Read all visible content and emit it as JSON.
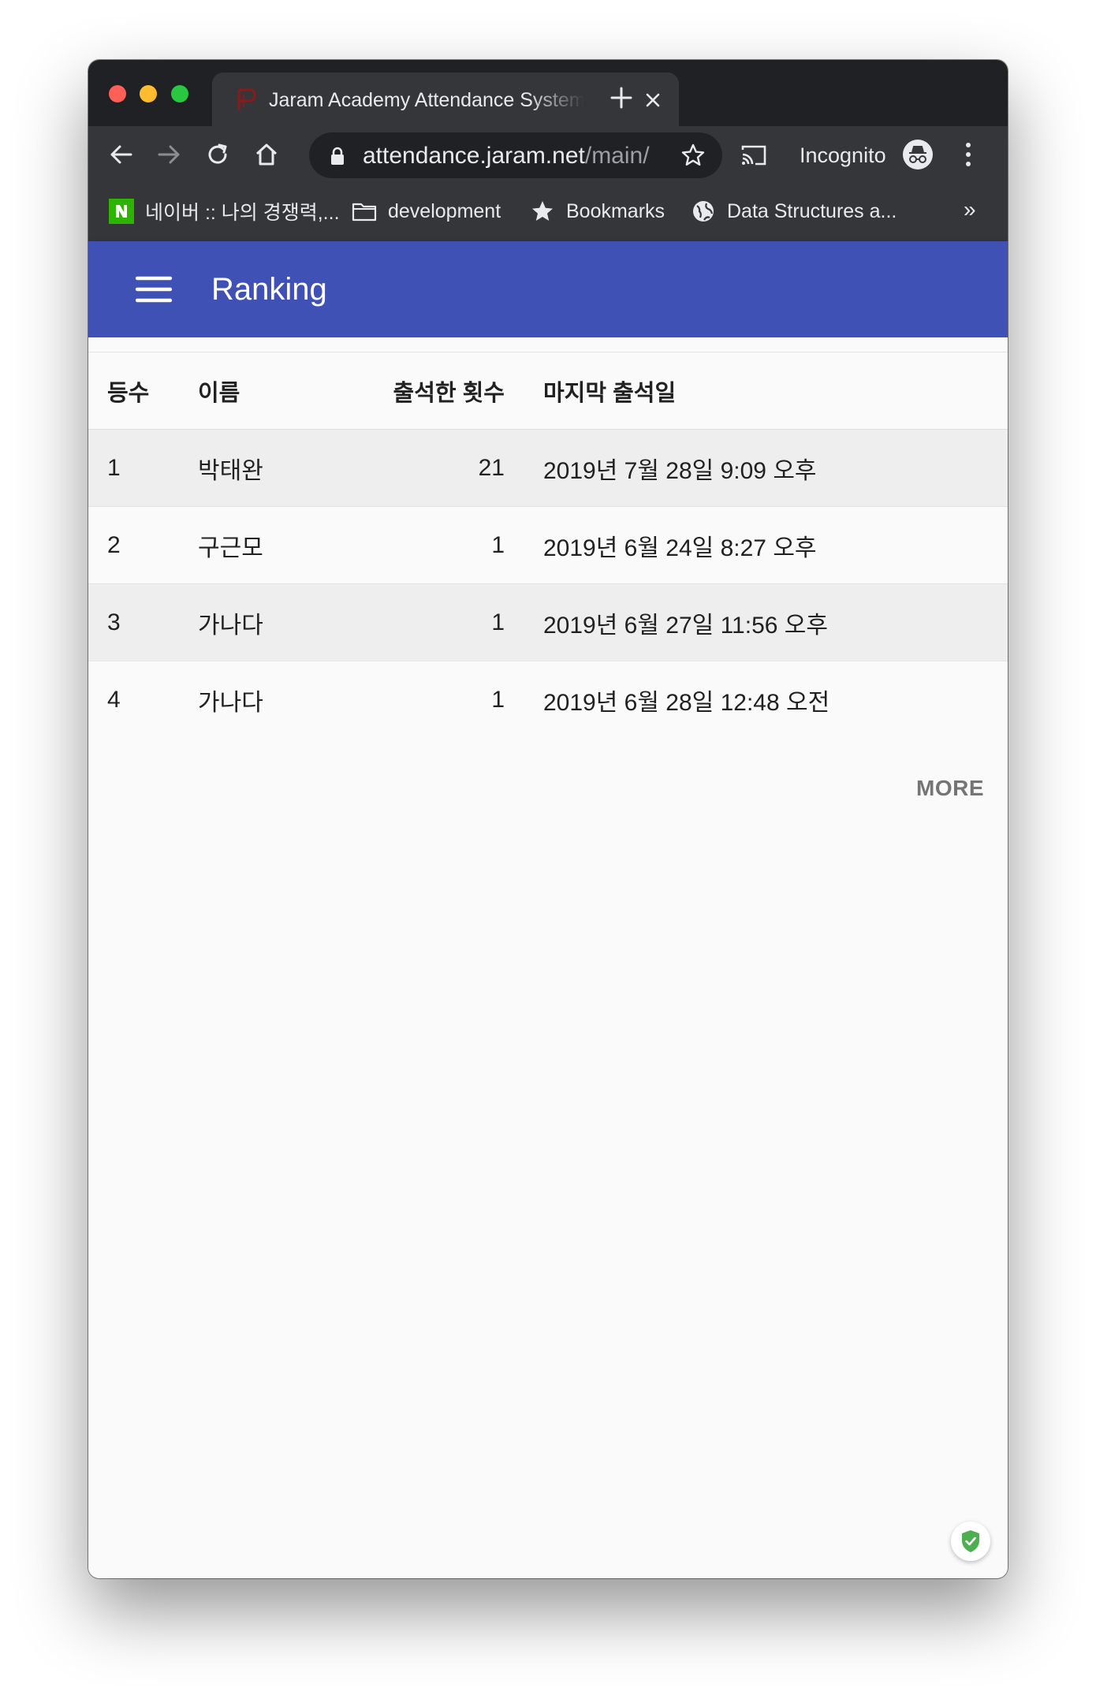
{
  "browser": {
    "tab_title": "Jaram Academy Attendance System",
    "url_host": "attendance.jaram.net",
    "url_path": "/main/",
    "incognito_label": "Incognito",
    "bookmarks": [
      {
        "icon": "naver-icon",
        "label": "네이버 :: 나의 경쟁력,..."
      },
      {
        "icon": "folder-icon",
        "label": "development"
      },
      {
        "icon": "star-icon",
        "label": "Bookmarks"
      },
      {
        "icon": "globe-icon",
        "label": "Data Structures a..."
      }
    ],
    "bookmarks_overflow": "»"
  },
  "appbar": {
    "title": "Ranking"
  },
  "table": {
    "headers": {
      "rank": "등수",
      "name": "이름",
      "count": "출석한 횟수",
      "last": "마지막 출석일"
    },
    "rows": [
      {
        "rank": "1",
        "name": "박태완",
        "count": "21",
        "last": "2019년 7월 28일 9:09 오후"
      },
      {
        "rank": "2",
        "name": "구근모",
        "count": "1",
        "last": "2019년 6월 24일 8:27 오후"
      },
      {
        "rank": "3",
        "name": "가나다",
        "count": "1",
        "last": "2019년 6월 27일 11:56 오후"
      },
      {
        "rank": "4",
        "name": "가나다",
        "count": "1",
        "last": "2019년 6월 28일 12:48 오전"
      }
    ]
  },
  "more_button": "MORE",
  "colors": {
    "appbar": "#3f51b5",
    "tabstrip": "#202124",
    "toolbar": "#35363a",
    "row_alt": "#eeeeee",
    "shield": "#4caf50"
  }
}
